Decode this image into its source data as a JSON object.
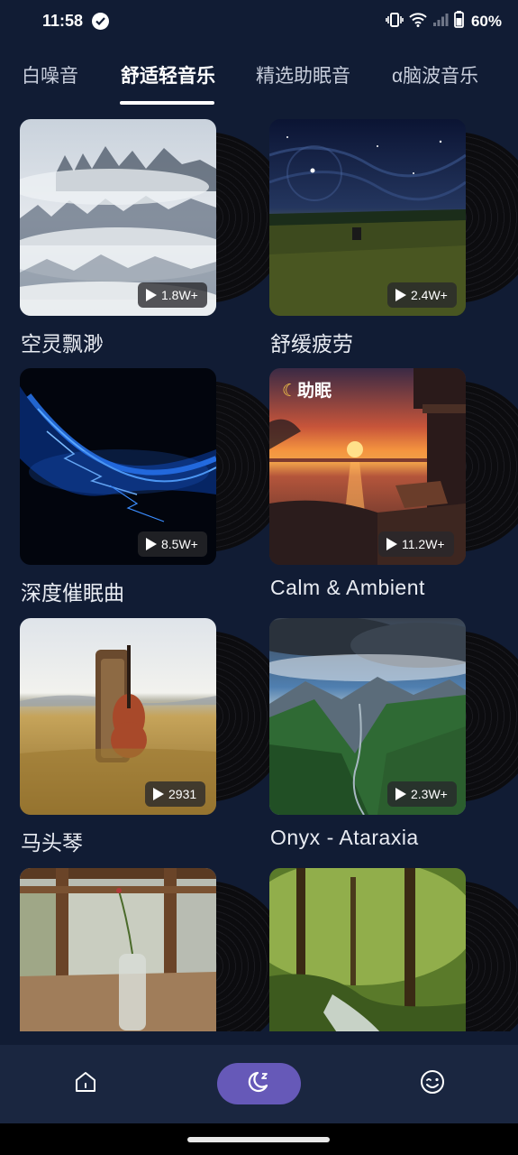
{
  "status": {
    "time": "11:58",
    "battery": "60%"
  },
  "tabs": [
    {
      "label": "白噪音"
    },
    {
      "label": "舒适轻音乐"
    },
    {
      "label": "精选助眠音"
    },
    {
      "label": "α脑波音乐"
    }
  ],
  "cards": [
    {
      "title": "空灵飘渺",
      "plays": "1.8W+"
    },
    {
      "title": "舒缓疲劳",
      "plays": "2.4W+"
    },
    {
      "title": "深度催眠曲",
      "plays": "8.5W+"
    },
    {
      "title": "Calm & Ambient",
      "plays": "11.2W+",
      "tag": "助眠"
    },
    {
      "title": "马头琴",
      "plays": "2931"
    },
    {
      "title": "Onyx - Ataraxia",
      "plays": "2.3W+"
    },
    {
      "title": ""
    },
    {
      "title": ""
    }
  ],
  "colors": {
    "background": "#111c34",
    "nav_background": "#1a2640",
    "active_pill": "#6659b8"
  },
  "icons": {
    "nav": [
      "home-icon",
      "moon-icon",
      "smile-icon"
    ]
  }
}
